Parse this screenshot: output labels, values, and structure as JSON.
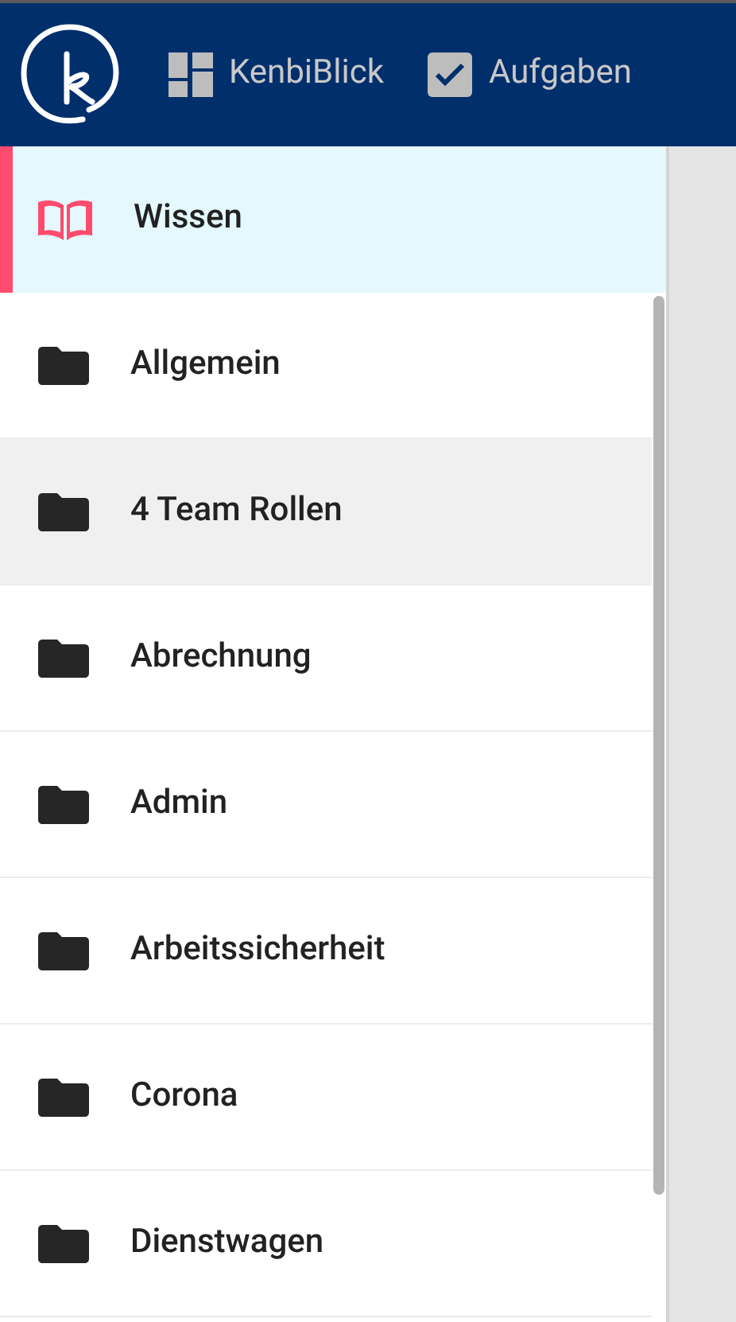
{
  "nav": [
    {
      "kind": "dashboard",
      "label": "KenbiBlick"
    },
    {
      "kind": "tasks",
      "label": "Aufgaben"
    }
  ],
  "section": {
    "label": "Wissen",
    "selected": true
  },
  "folders": [
    {
      "label": "Allgemein",
      "highlighted": false
    },
    {
      "label": "4 Team Rollen",
      "highlighted": true
    },
    {
      "label": "Abrechnung",
      "highlighted": false
    },
    {
      "label": "Admin",
      "highlighted": false
    },
    {
      "label": "Arbeitssicherheit",
      "highlighted": false
    },
    {
      "label": "Corona",
      "highlighted": false
    },
    {
      "label": "Dienstwagen",
      "highlighted": false
    }
  ]
}
